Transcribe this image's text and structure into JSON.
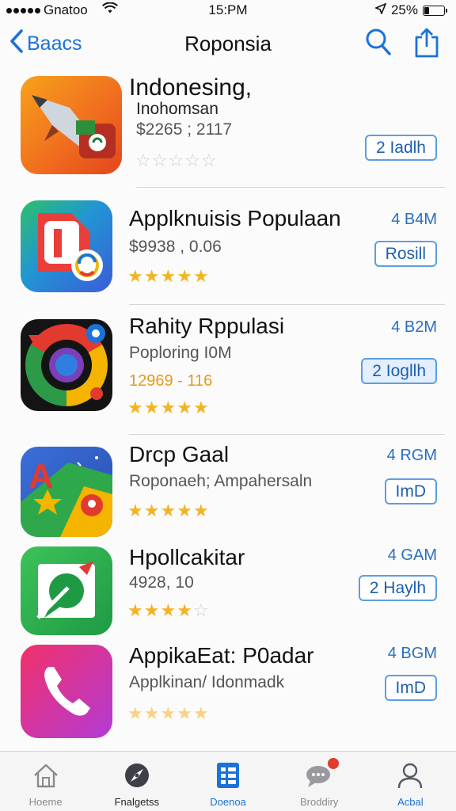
{
  "status_bar": {
    "carrier": "Gnatoo",
    "time": "15:PM",
    "battery_text": "25%",
    "battery_level": 0.25
  },
  "nav": {
    "back_label": "Baacs",
    "title": "Roponsia",
    "icons": [
      "chevron-left-icon",
      "search-icon",
      "share-icon"
    ]
  },
  "apps": [
    {
      "title": "Indonesing,",
      "subtitle": "Inohomsan",
      "price": "$2265 ; 2117",
      "size": "",
      "action": "2 Iadlh",
      "action_style": "outline",
      "rating": 0,
      "icon": "rocket-game-icon"
    },
    {
      "title": "Applknuisis Populaan",
      "subtitle": "",
      "price": "$9938 , 0.06",
      "size": "4 B4M",
      "action": "Rosill",
      "action_style": "outline",
      "rating": 4.5,
      "icon": "b-logo-icon"
    },
    {
      "title": "Rahity Rppulasi",
      "subtitle": "Poploring I0M",
      "price": "12969 - 116",
      "size": "4 B2M",
      "action": "2 Iogllh",
      "action_style": "filled",
      "rating": 4.5,
      "icon": "chrome-ring-icon"
    },
    {
      "title": "Drcp Gaal",
      "subtitle": "Roponaeh; Ampahersaln",
      "price": "",
      "size": "4 RGM",
      "action": "ImD",
      "action_style": "outline",
      "rating": 4.5,
      "icon": "maps-a-icon"
    },
    {
      "title": "Hpollcakitar",
      "subtitle": "",
      "price": "4928, 10",
      "size": "4 GAM",
      "action": "2 Haylh",
      "action_style": "outline",
      "rating": 4,
      "icon": "chat-pin-icon"
    },
    {
      "title": "AppikaEat: P0adar",
      "subtitle": "Applkinan/ Idonmadk",
      "price": "",
      "size": "4 BGM",
      "action": "ImD",
      "action_style": "outline",
      "rating": 5,
      "icon": "phone-icon"
    }
  ],
  "tabs": [
    {
      "label": "Hoeme",
      "icon": "home-icon"
    },
    {
      "label": "Fnalgetss",
      "icon": "compass-icon"
    },
    {
      "label": "Doenoa",
      "icon": "apps-list-icon",
      "active": true
    },
    {
      "label": "Broddiry",
      "icon": "chat-bubble-icon",
      "badge": true
    },
    {
      "label": "Acbal",
      "icon": "person-icon"
    }
  ],
  "colors": {
    "accent": "#1a73d8",
    "star": "#f3b422",
    "badge": "#e33b2e"
  }
}
